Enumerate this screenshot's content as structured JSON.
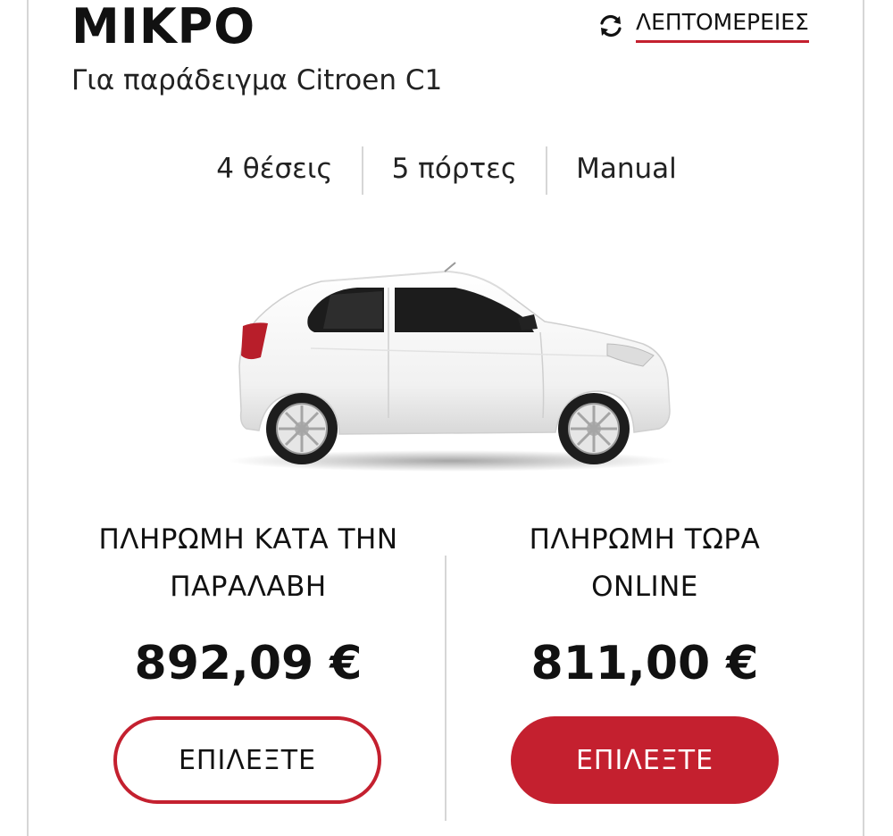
{
  "card": {
    "title": "ΜΙΚΡΟ",
    "subtitle": "Για παράδειγμα Citroen C1",
    "details_link": {
      "label": "ΛΕΠΤΟΜΕΡΕΙΕΣ",
      "icon": "swap-arrows-icon"
    },
    "specs": [
      {
        "label": "4 θέσεις"
      },
      {
        "label": "5 πόρτες"
      },
      {
        "label": "Manual"
      }
    ],
    "image": {
      "icon": "car-image"
    }
  },
  "payment_options": [
    {
      "title_line1": "ΠΛΗΡΩΜΗ ΚΑΤΑ ΤΗΝ",
      "title_line2": "ΠΑΡΑΛΑΒΗ",
      "price": "892,09 €",
      "button_label": "ΕΠΙΛΕΞΤΕ",
      "button_style": "outline"
    },
    {
      "title_line1": "ΠΛΗΡΩΜΗ ΤΩΡΑ",
      "title_line2": "ONLINE",
      "price": "811,00 €",
      "button_label": "ΕΠΙΛΕΞΤΕ",
      "button_style": "filled"
    }
  ],
  "colors": {
    "accent": "#c4202f",
    "border": "#d6d6d6",
    "text": "#111111"
  }
}
